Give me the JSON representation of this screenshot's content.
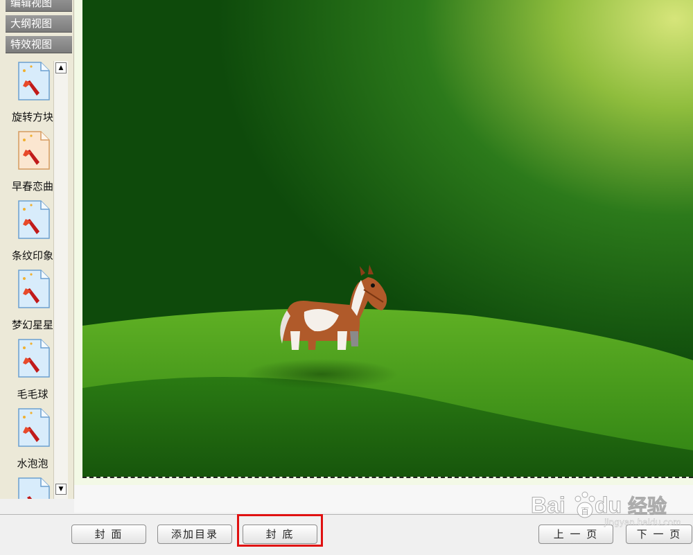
{
  "view_tabs": [
    "编辑视图",
    "大纲视图",
    "特效视图"
  ],
  "effects": [
    {
      "label": "旋转方块"
    },
    {
      "label": "早春恋曲"
    },
    {
      "label": "条纹印象"
    },
    {
      "label": "梦幻星星"
    },
    {
      "label": "毛毛球"
    },
    {
      "label": "水泡泡"
    }
  ],
  "scroll": {
    "up": "▲",
    "down": "▼"
  },
  "toolbar": {
    "cover": "封 面",
    "add_toc": "添加目录",
    "back_cover": "封 底",
    "prev_page": "上 一 页",
    "next_page": "下 一 页"
  },
  "watermark": {
    "brand": "Bai",
    "brand2": "百",
    "brand3": "du",
    "text": "经验",
    "url": "jingyan.baidu.com"
  },
  "colors": {
    "highlight": "#e01010",
    "page_green": "#1e6e14"
  }
}
